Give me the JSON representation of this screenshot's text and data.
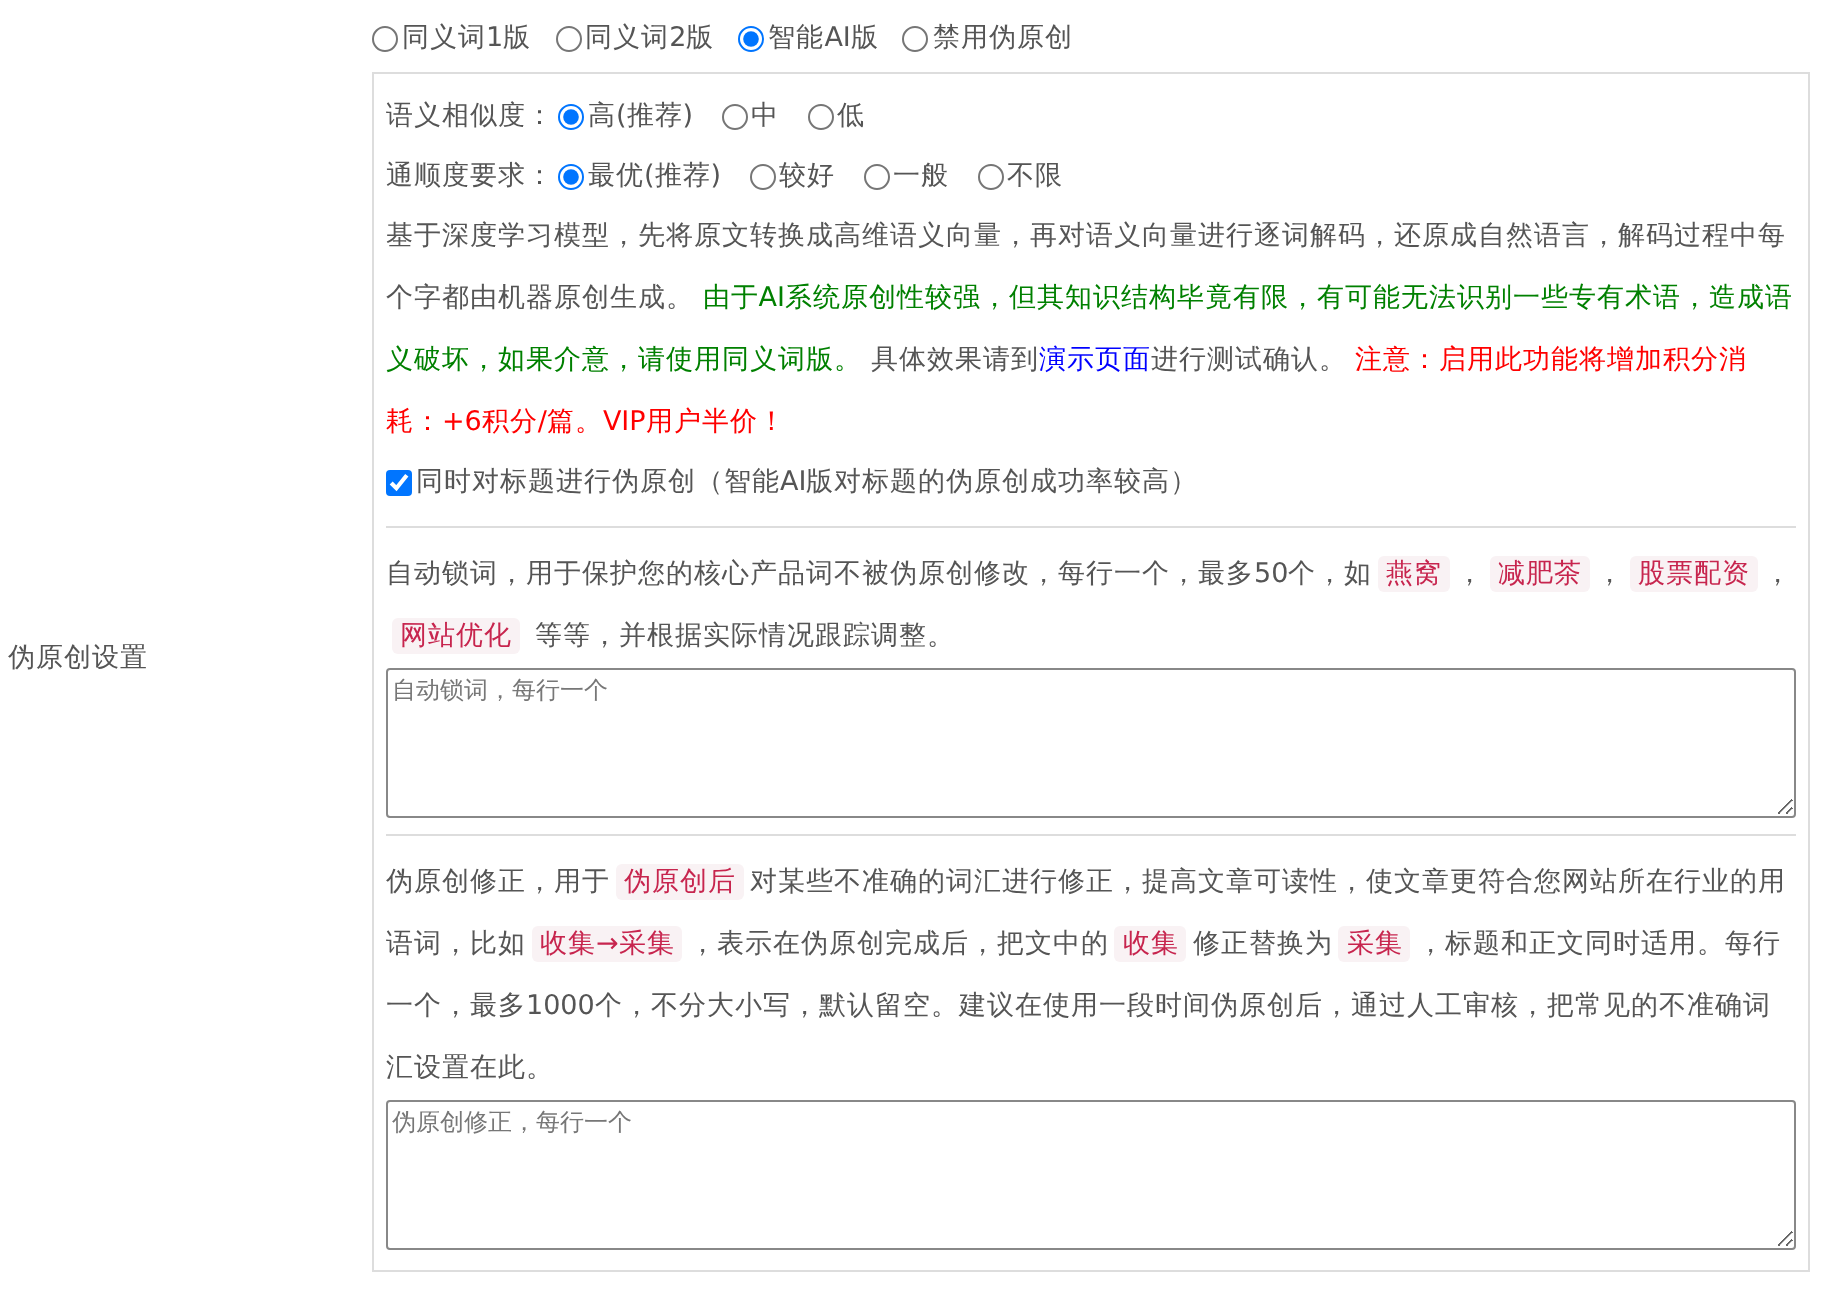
{
  "settings_label": "伪原创设置",
  "versions": [
    {
      "label": "同义词1版",
      "selected": false
    },
    {
      "label": "同义词2版",
      "selected": false
    },
    {
      "label": "智能AI版",
      "selected": true
    },
    {
      "label": "禁用伪原创",
      "selected": false
    }
  ],
  "similarity": {
    "label": "语义相似度：",
    "options": [
      {
        "label": "高(推荐)",
        "selected": true
      },
      {
        "label": "中",
        "selected": false
      },
      {
        "label": "低",
        "selected": false
      }
    ]
  },
  "fluency": {
    "label": "通顺度要求：",
    "options": [
      {
        "label": "最优(推荐)",
        "selected": true
      },
      {
        "label": "较好",
        "selected": false
      },
      {
        "label": "一般",
        "selected": false
      },
      {
        "label": "不限",
        "selected": false
      }
    ]
  },
  "description": [
    {
      "kind": "plain",
      "text": "基于深度学习模型，先将原文转换成高维语义向量，再对语义向量进行逐词解码，还原成自然语言，解码过程中每个字都由机器原创生成。 "
    },
    {
      "kind": "note",
      "text": "由于AI系统原创性较强，但其知识结构毕竟有限，有可能无法识别一些专有术语，造成语义破坏，如果介意，请使用同义词版。"
    },
    {
      "kind": "plain",
      "text": " 具体效果请到"
    },
    {
      "kind": "link",
      "text": "演示页面"
    },
    {
      "kind": "plain",
      "text": "进行测试确认。 "
    },
    {
      "kind": "warning",
      "text": "注意：启用此功能将增加积分消耗：+6积分/篇。VIP用户半价！"
    }
  ],
  "title_option": {
    "label": "同时对标题进行伪原创（智能AI版对标题的伪原创成功率较高）",
    "checked": true
  },
  "lock_words": {
    "intro": [
      {
        "kind": "plain",
        "text": "自动锁词，用于保护您的核心产品词不被伪原创修改，每行一个，最多50个，如"
      },
      {
        "kind": "tag",
        "text": "燕窝"
      },
      {
        "kind": "plain",
        "text": "，"
      },
      {
        "kind": "tag",
        "text": "减肥茶"
      },
      {
        "kind": "plain",
        "text": "，"
      },
      {
        "kind": "tag",
        "text": "股票配资"
      },
      {
        "kind": "plain",
        "text": "，"
      },
      {
        "kind": "tag",
        "text": "网站优化"
      },
      {
        "kind": "plain",
        "text": " 等等，并根据实际情况跟踪调整。"
      }
    ],
    "placeholder": "自动锁词，每行一个"
  },
  "correction": {
    "intro": [
      {
        "kind": "plain",
        "text": "伪原创修正，用于"
      },
      {
        "kind": "tag",
        "text": "伪原创后"
      },
      {
        "kind": "plain",
        "text": "对某些不准确的词汇进行修正，提高文章可读性，使文章更符合您网站所在行业的用语词，比如"
      },
      {
        "kind": "tag",
        "text": "收集→采集"
      },
      {
        "kind": "plain",
        "text": "，表示在伪原创完成后，把文中的"
      },
      {
        "kind": "tag",
        "text": "收集"
      },
      {
        "kind": "plain",
        "text": "修正替换为"
      },
      {
        "kind": "tag",
        "text": "采集"
      },
      {
        "kind": "plain",
        "text": "，标题和正文同时适用。每行一个，最多1000个，不分大小写，默认留空。建议在使用一段时间伪原创后，通过人工审核，把常见的不准确词汇设置在此。"
      }
    ],
    "placeholder": "伪原创修正，每行一个"
  }
}
